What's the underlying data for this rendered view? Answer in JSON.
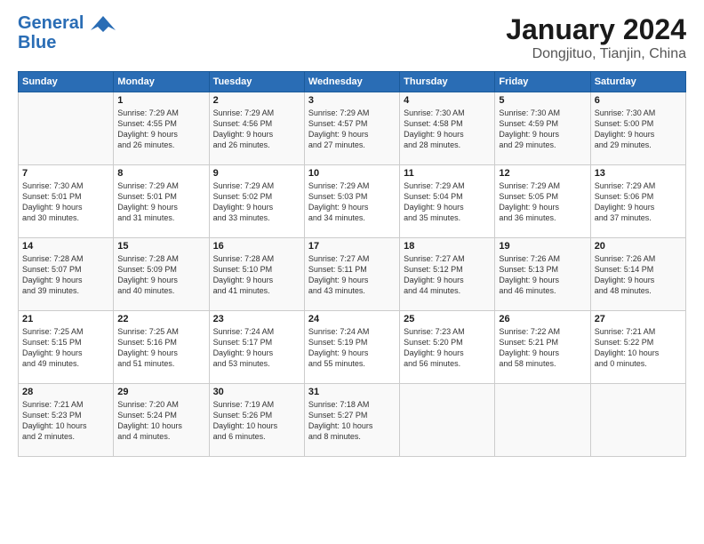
{
  "header": {
    "logo_line1": "General",
    "logo_line2": "Blue",
    "title": "January 2024",
    "location": "Dongjituo, Tianjin, China"
  },
  "days_of_week": [
    "Sunday",
    "Monday",
    "Tuesday",
    "Wednesday",
    "Thursday",
    "Friday",
    "Saturday"
  ],
  "weeks": [
    [
      {
        "day": "",
        "info": ""
      },
      {
        "day": "1",
        "info": "Sunrise: 7:29 AM\nSunset: 4:55 PM\nDaylight: 9 hours\nand 26 minutes."
      },
      {
        "day": "2",
        "info": "Sunrise: 7:29 AM\nSunset: 4:56 PM\nDaylight: 9 hours\nand 26 minutes."
      },
      {
        "day": "3",
        "info": "Sunrise: 7:29 AM\nSunset: 4:57 PM\nDaylight: 9 hours\nand 27 minutes."
      },
      {
        "day": "4",
        "info": "Sunrise: 7:30 AM\nSunset: 4:58 PM\nDaylight: 9 hours\nand 28 minutes."
      },
      {
        "day": "5",
        "info": "Sunrise: 7:30 AM\nSunset: 4:59 PM\nDaylight: 9 hours\nand 29 minutes."
      },
      {
        "day": "6",
        "info": "Sunrise: 7:30 AM\nSunset: 5:00 PM\nDaylight: 9 hours\nand 29 minutes."
      }
    ],
    [
      {
        "day": "7",
        "info": "Sunrise: 7:30 AM\nSunset: 5:01 PM\nDaylight: 9 hours\nand 30 minutes."
      },
      {
        "day": "8",
        "info": "Sunrise: 7:29 AM\nSunset: 5:01 PM\nDaylight: 9 hours\nand 31 minutes."
      },
      {
        "day": "9",
        "info": "Sunrise: 7:29 AM\nSunset: 5:02 PM\nDaylight: 9 hours\nand 33 minutes."
      },
      {
        "day": "10",
        "info": "Sunrise: 7:29 AM\nSunset: 5:03 PM\nDaylight: 9 hours\nand 34 minutes."
      },
      {
        "day": "11",
        "info": "Sunrise: 7:29 AM\nSunset: 5:04 PM\nDaylight: 9 hours\nand 35 minutes."
      },
      {
        "day": "12",
        "info": "Sunrise: 7:29 AM\nSunset: 5:05 PM\nDaylight: 9 hours\nand 36 minutes."
      },
      {
        "day": "13",
        "info": "Sunrise: 7:29 AM\nSunset: 5:06 PM\nDaylight: 9 hours\nand 37 minutes."
      }
    ],
    [
      {
        "day": "14",
        "info": "Sunrise: 7:28 AM\nSunset: 5:07 PM\nDaylight: 9 hours\nand 39 minutes."
      },
      {
        "day": "15",
        "info": "Sunrise: 7:28 AM\nSunset: 5:09 PM\nDaylight: 9 hours\nand 40 minutes."
      },
      {
        "day": "16",
        "info": "Sunrise: 7:28 AM\nSunset: 5:10 PM\nDaylight: 9 hours\nand 41 minutes."
      },
      {
        "day": "17",
        "info": "Sunrise: 7:27 AM\nSunset: 5:11 PM\nDaylight: 9 hours\nand 43 minutes."
      },
      {
        "day": "18",
        "info": "Sunrise: 7:27 AM\nSunset: 5:12 PM\nDaylight: 9 hours\nand 44 minutes."
      },
      {
        "day": "19",
        "info": "Sunrise: 7:26 AM\nSunset: 5:13 PM\nDaylight: 9 hours\nand 46 minutes."
      },
      {
        "day": "20",
        "info": "Sunrise: 7:26 AM\nSunset: 5:14 PM\nDaylight: 9 hours\nand 48 minutes."
      }
    ],
    [
      {
        "day": "21",
        "info": "Sunrise: 7:25 AM\nSunset: 5:15 PM\nDaylight: 9 hours\nand 49 minutes."
      },
      {
        "day": "22",
        "info": "Sunrise: 7:25 AM\nSunset: 5:16 PM\nDaylight: 9 hours\nand 51 minutes."
      },
      {
        "day": "23",
        "info": "Sunrise: 7:24 AM\nSunset: 5:17 PM\nDaylight: 9 hours\nand 53 minutes."
      },
      {
        "day": "24",
        "info": "Sunrise: 7:24 AM\nSunset: 5:19 PM\nDaylight: 9 hours\nand 55 minutes."
      },
      {
        "day": "25",
        "info": "Sunrise: 7:23 AM\nSunset: 5:20 PM\nDaylight: 9 hours\nand 56 minutes."
      },
      {
        "day": "26",
        "info": "Sunrise: 7:22 AM\nSunset: 5:21 PM\nDaylight: 9 hours\nand 58 minutes."
      },
      {
        "day": "27",
        "info": "Sunrise: 7:21 AM\nSunset: 5:22 PM\nDaylight: 10 hours\nand 0 minutes."
      }
    ],
    [
      {
        "day": "28",
        "info": "Sunrise: 7:21 AM\nSunset: 5:23 PM\nDaylight: 10 hours\nand 2 minutes."
      },
      {
        "day": "29",
        "info": "Sunrise: 7:20 AM\nSunset: 5:24 PM\nDaylight: 10 hours\nand 4 minutes."
      },
      {
        "day": "30",
        "info": "Sunrise: 7:19 AM\nSunset: 5:26 PM\nDaylight: 10 hours\nand 6 minutes."
      },
      {
        "day": "31",
        "info": "Sunrise: 7:18 AM\nSunset: 5:27 PM\nDaylight: 10 hours\nand 8 minutes."
      },
      {
        "day": "",
        "info": ""
      },
      {
        "day": "",
        "info": ""
      },
      {
        "day": "",
        "info": ""
      }
    ]
  ]
}
